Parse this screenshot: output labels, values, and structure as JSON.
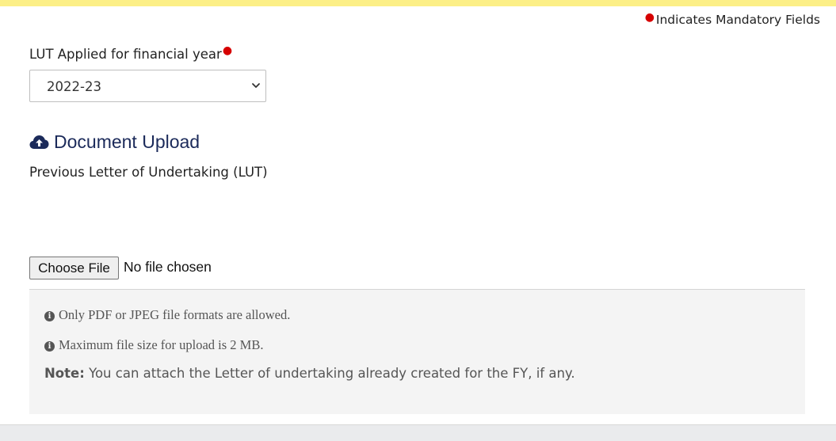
{
  "header": {
    "mandatory_note": "Indicates Mandatory Fields",
    "accent_color": "#fcef87",
    "required_color": "#d60000"
  },
  "form": {
    "lut_label": "LUT Applied for financial year",
    "financial_year_selected": "2022-23"
  },
  "upload": {
    "section_title": "Document Upload",
    "section_icon": "cloud-upload-icon",
    "field_label": "Previous Letter of Undertaking (LUT)",
    "choose_button": "Choose File",
    "file_status": "No file chosen"
  },
  "info": {
    "formats": "Only PDF or JPEG file formats are allowed.",
    "max_size": "Maximum file size for upload is 2 MB.",
    "note_label": "Note:",
    "note_text": " You can attach the Letter of undertaking already created for the FY, if any."
  }
}
